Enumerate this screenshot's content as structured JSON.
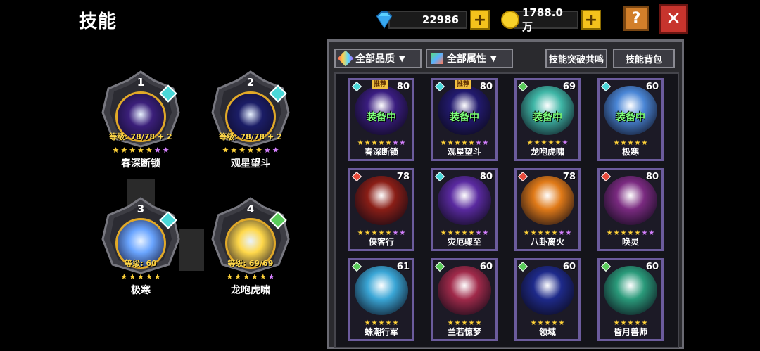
{
  "header": {
    "title": "技能",
    "gems": "22986",
    "gold": "1788.0万",
    "plus": "+",
    "help": "?",
    "close": "✕"
  },
  "colors": {
    "accent_gold": "#f4c21c",
    "close_red": "#c7342d",
    "help_orange": "#d27f2a",
    "equipped_green": "#7dff7a"
  },
  "equipped_slots": [
    {
      "num": "1",
      "level": "等级: 78/78 + 2",
      "name": "春深断锁",
      "stars": 5,
      "purple_stars": 2,
      "element": "ice",
      "orb_color": "#3b1f7a"
    },
    {
      "num": "2",
      "level": "等级: 78/78 + 2",
      "name": "观星望斗",
      "stars": 5,
      "purple_stars": 2,
      "element": "ice",
      "orb_color": "#1b1d66"
    },
    {
      "num": "3",
      "level": "等级: 60",
      "name": "极寒",
      "stars": 5,
      "purple_stars": 0,
      "element": "ice",
      "orb_color": "#6aa5ff"
    },
    {
      "num": "4",
      "level": "等级: 69/69",
      "name": "龙咆虎啸",
      "stars": 5,
      "purple_stars": 1,
      "element": "nature",
      "orb_color": "#ffd84a"
    }
  ],
  "panel": {
    "quality_filter": "全部品质",
    "attribute_filter": "全部属性",
    "resonance_button": "技能突破共鸣",
    "bag_button": "技能背包"
  },
  "labels": {
    "equipped": "装备中",
    "recommended": "推荐"
  },
  "skills": [
    {
      "name": "春深断锁",
      "level": "80",
      "equipped": true,
      "recommended": true,
      "element": "ice",
      "stars": 5,
      "purple_stars": 2,
      "art_color": "#3a1d80"
    },
    {
      "name": "观星望斗",
      "level": "80",
      "equipped": true,
      "recommended": true,
      "element": "ice",
      "stars": 5,
      "purple_stars": 2,
      "art_color": "#221a6e"
    },
    {
      "name": "龙咆虎啸",
      "level": "69",
      "equipped": true,
      "recommended": false,
      "element": "nature",
      "stars": 5,
      "purple_stars": 1,
      "art_color": "#3fb6a6"
    },
    {
      "name": "极寒",
      "level": "60",
      "equipped": true,
      "recommended": false,
      "element": "ice",
      "stars": 5,
      "purple_stars": 0,
      "art_color": "#4a86d6"
    },
    {
      "name": "侠客行",
      "level": "78",
      "equipped": false,
      "recommended": false,
      "element": "fire",
      "stars": 5,
      "purple_stars": 2,
      "art_color": "#8a1e16"
    },
    {
      "name": "灾厄骤至",
      "level": "80",
      "equipped": false,
      "recommended": false,
      "element": "ice",
      "stars": 5,
      "purple_stars": 2,
      "art_color": "#5a2aa0"
    },
    {
      "name": "八卦离火",
      "level": "78",
      "equipped": false,
      "recommended": false,
      "element": "fire",
      "stars": 5,
      "purple_stars": 2,
      "art_color": "#e07a18"
    },
    {
      "name": "唤灵",
      "level": "80",
      "equipped": false,
      "recommended": false,
      "element": "fire",
      "stars": 5,
      "purple_stars": 2,
      "art_color": "#7a2a80"
    },
    {
      "name": "蛛潮行军",
      "level": "61",
      "equipped": false,
      "recommended": false,
      "element": "nature",
      "stars": 5,
      "purple_stars": 0,
      "art_color": "#3aa6d6"
    },
    {
      "name": "兰若惊梦",
      "level": "60",
      "equipped": false,
      "recommended": false,
      "element": "nature",
      "stars": 5,
      "purple_stars": 0,
      "art_color": "#a02a4a"
    },
    {
      "name": "领域",
      "level": "60",
      "equipped": false,
      "recommended": false,
      "element": "nature",
      "stars": 5,
      "purple_stars": 0,
      "art_color": "#1e2a8a"
    },
    {
      "name": "昏月兽师",
      "level": "60",
      "equipped": false,
      "recommended": false,
      "element": "nature",
      "stars": 5,
      "purple_stars": 0,
      "art_color": "#2a9a7a"
    }
  ]
}
